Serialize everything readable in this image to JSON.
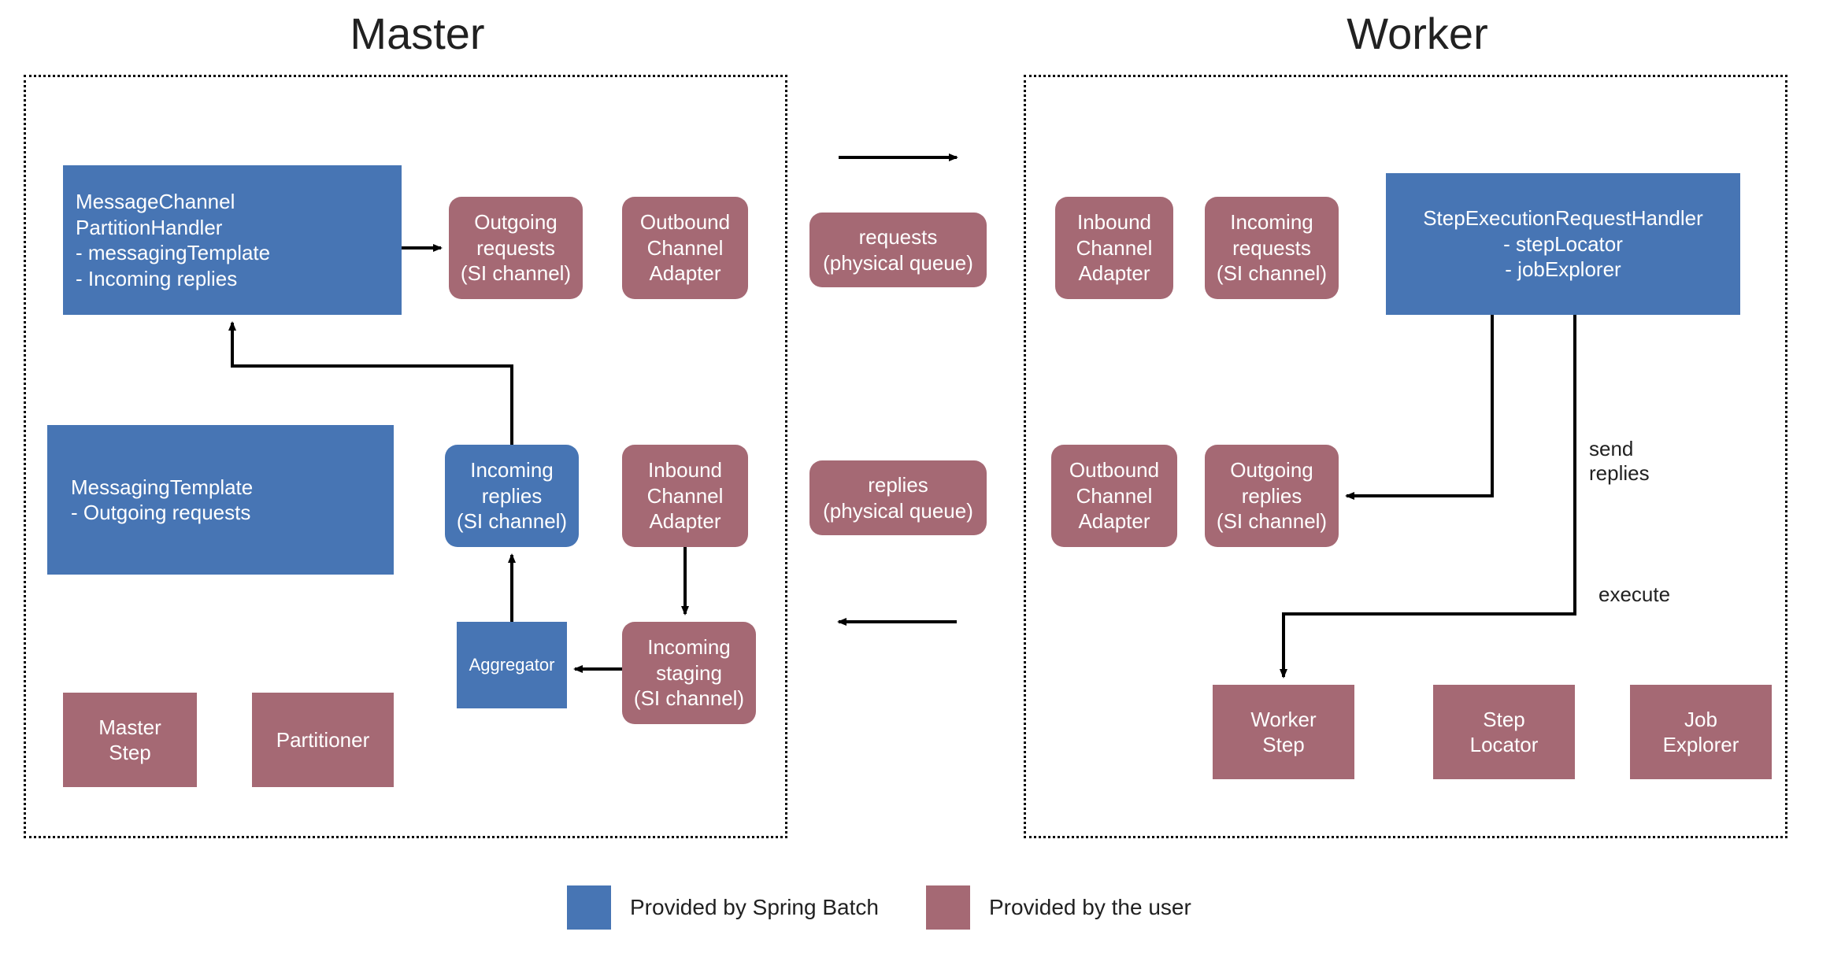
{
  "titles": {
    "master": "Master",
    "worker": "Worker"
  },
  "master": {
    "partitionHandler": {
      "l1": "MessageChannel",
      "l2": "PartitionHandler",
      "l3": "- messagingTemplate",
      "l4": "- Incoming replies"
    },
    "messagingTemplate": {
      "l1": "MessagingTemplate",
      "l2": "- Outgoing requests"
    },
    "outgoingRequests": {
      "l1": "Outgoing",
      "l2": "requests",
      "l3": "(SI channel)"
    },
    "outboundAdapter": {
      "l1": "Outbound",
      "l2": "Channel",
      "l3": "Adapter"
    },
    "incomingReplies": {
      "l1": "Incoming",
      "l2": "replies",
      "l3": "(SI channel)"
    },
    "inboundAdapter": {
      "l1": "Inbound",
      "l2": "Channel",
      "l3": "Adapter"
    },
    "aggregator": "Aggregator",
    "incomingStaging": {
      "l1": "Incoming",
      "l2": "staging",
      "l3": "(SI channel)"
    },
    "masterStep": {
      "l1": "Master",
      "l2": "Step"
    },
    "partitioner": "Partitioner"
  },
  "middle": {
    "requests": {
      "l1": "requests",
      "l2": "(physical queue)"
    },
    "replies": {
      "l1": "replies",
      "l2": "(physical queue)"
    }
  },
  "worker": {
    "inboundAdapter": {
      "l1": "Inbound",
      "l2": "Channel",
      "l3": "Adapter"
    },
    "incomingRequests": {
      "l1": "Incoming",
      "l2": "requests",
      "l3": "(SI channel)"
    },
    "requestHandler": {
      "l1": "StepExecutionRequestHandler",
      "l2": "- stepLocator",
      "l3": "- jobExplorer"
    },
    "outboundAdapter": {
      "l1": "Outbound",
      "l2": "Channel",
      "l3": "Adapter"
    },
    "outgoingReplies": {
      "l1": "Outgoing",
      "l2": "replies",
      "l3": "(SI channel)"
    },
    "sendReplies": {
      "l1": "send",
      "l2": "replies"
    },
    "execute": "execute",
    "workerStep": {
      "l1": "Worker",
      "l2": "Step"
    },
    "stepLocator": {
      "l1": "Step",
      "l2": "Locator"
    },
    "jobExplorer": {
      "l1": "Job",
      "l2": "Explorer"
    }
  },
  "legend": {
    "spring": "Provided by Spring Batch",
    "user": "Provided by the user"
  }
}
